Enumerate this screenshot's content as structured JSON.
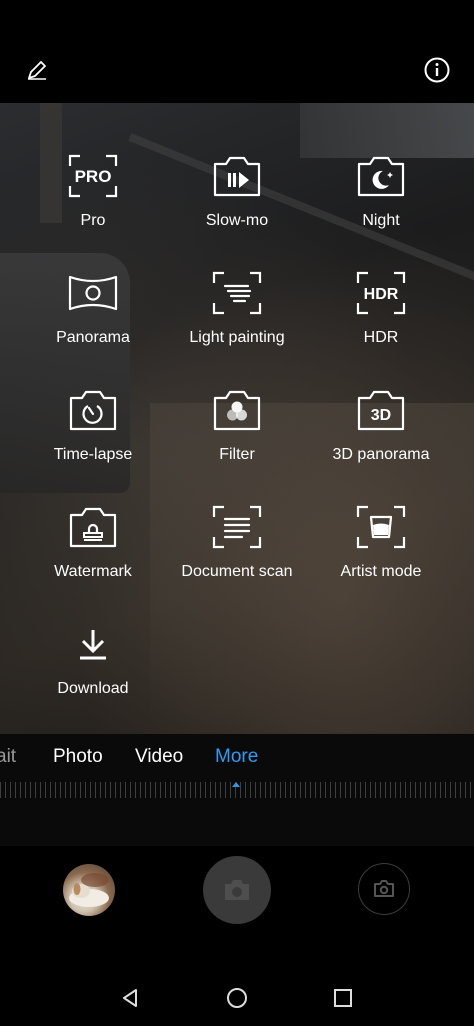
{
  "top_bar": {
    "edit_icon": "pencil-icon",
    "info_icon": "info-icon"
  },
  "modes": [
    {
      "label": "Pro",
      "icon": "pro-icon"
    },
    {
      "label": "Slow-mo",
      "icon": "slow-mo-icon"
    },
    {
      "label": "Night",
      "icon": "night-icon"
    },
    {
      "label": "Panorama",
      "icon": "panorama-icon"
    },
    {
      "label": "Light painting",
      "icon": "light-painting-icon"
    },
    {
      "label": "HDR",
      "icon": "hdr-icon"
    },
    {
      "label": "Time-lapse",
      "icon": "time-lapse-icon"
    },
    {
      "label": "Filter",
      "icon": "filter-icon"
    },
    {
      "label": "3D panorama",
      "icon": "3d-panorama-icon"
    },
    {
      "label": "Watermark",
      "icon": "watermark-icon"
    },
    {
      "label": "Document scan",
      "icon": "document-scan-icon"
    },
    {
      "label": "Artist mode",
      "icon": "artist-mode-icon"
    },
    {
      "label": "Download",
      "icon": "download-icon"
    }
  ],
  "icon_text": {
    "pro": "PRO",
    "hdr": "HDR",
    "threed": "3D"
  },
  "mode_tabs": {
    "partial": "ait",
    "photo": "Photo",
    "video": "Video",
    "more": "More",
    "active": "More"
  },
  "colors": {
    "accent": "#2f9bf2",
    "background": "#000000",
    "shutter": "#3a3a3a"
  },
  "bottom_controls": {
    "gallery_icon": "gallery-thumbnail",
    "shutter_icon": "camera-icon",
    "switch_icon": "switch-camera-icon"
  },
  "nav_bar": {
    "back_icon": "back-icon",
    "home_icon": "home-icon",
    "recent_icon": "recent-apps-icon"
  }
}
